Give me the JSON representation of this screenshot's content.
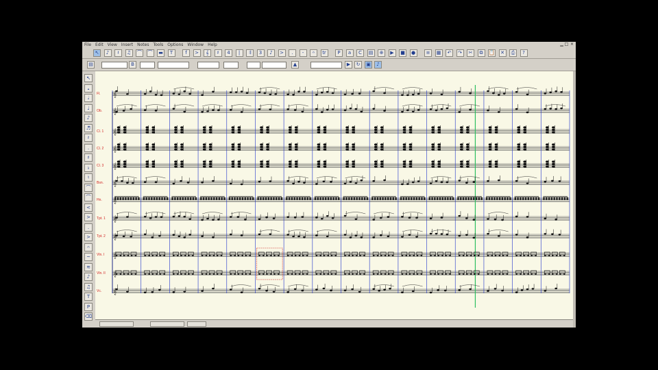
{
  "menubar": {
    "items": [
      "File",
      "Edit",
      "View",
      "Insert",
      "Notes",
      "Tools",
      "Options",
      "Window",
      "Help"
    ]
  },
  "toolbar": {
    "row1_icons": [
      "select-icon",
      "note-icon",
      "rest-icon",
      "chord-icon",
      "tie-icon",
      "slur-icon",
      "beam-icon",
      "text-icon",
      "dynamic-icon",
      "articulation-icon",
      "clef-icon",
      "key-icon",
      "time-icon",
      "barline-icon",
      "repeat-icon",
      "tuplet-icon",
      "grace-icon",
      "accent-icon",
      "staccato-icon",
      "tenuto-icon",
      "fermata-icon",
      "trill-icon",
      "pedal-icon",
      "lyric-icon",
      "chord-symbol-icon",
      "page-icon",
      "zoom-icon",
      "play-icon",
      "stop-icon",
      "record-icon",
      "mixer-icon",
      "layout-icon",
      "undo-icon",
      "redo-icon",
      "cut-icon",
      "copy-icon",
      "paste-icon",
      "delete-icon",
      "print-icon",
      "help-icon"
    ],
    "row2_fields": {
      "zoom_value": "",
      "tempo_value": "",
      "voice_value": "",
      "layer_value": ""
    }
  },
  "palette": {
    "icons": [
      "pointer-icon",
      "whole-note-icon",
      "half-note-icon",
      "quarter-note-icon",
      "eighth-note-icon",
      "sixteenth-note-icon",
      "rest-icon",
      "dot-icon",
      "sharp-icon",
      "flat-icon",
      "natural-icon",
      "tie-icon",
      "slur-icon",
      "cresc-icon",
      "dim-icon",
      "staccato-icon",
      "accent-icon",
      "fermata-icon",
      "trill-icon",
      "tremolo-icon",
      "grace-icon",
      "chord-icon",
      "text-icon",
      "pedal-icon",
      "eraser-icon"
    ]
  },
  "score": {
    "staff_labels": [
      "Fl.",
      "Ob.",
      "Cl. 1",
      "Cl. 2",
      "Cl. 3",
      "Bsn.",
      "Hn.",
      "Tpt. 1",
      "Tpt. 2",
      "Vln. I",
      "Vln. II",
      "Vc."
    ],
    "measure_count": 16,
    "playhead_measure": 13
  },
  "statusbar": {
    "position": "",
    "mode": ""
  },
  "colors": {
    "paper": "#f9f8e6",
    "barline": "#1a2fcc",
    "playhead": "#2cc060",
    "staff_label": "#d02020"
  }
}
